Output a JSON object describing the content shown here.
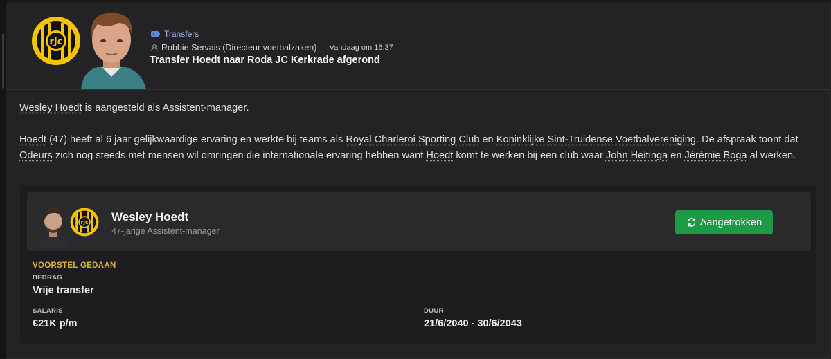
{
  "message": {
    "category": "Transfers",
    "sender": "Robbie Servais (Directeur voetbalzaken)",
    "separator": "-",
    "time": "Vandaag om 16:37",
    "subject": "Transfer Hoedt naar Roda JC Kerkrade afgerond",
    "club_logo_text": "RODA JC KERKRADE",
    "icons": {
      "category": "tag-icon",
      "sender": "person-icon"
    }
  },
  "body": {
    "p1": [
      {
        "text": "Wesley Hoedt",
        "link": true
      },
      {
        "text": " is aangesteld als Assistent-manager.",
        "link": false
      }
    ],
    "p2": [
      {
        "text": "Hoedt",
        "link": true
      },
      {
        "text": " (47) heeft al 6 jaar gelijkwaardige ervaring en werkte bij teams als ",
        "link": false
      },
      {
        "text": "Royal Charleroi Sporting Club",
        "link": true
      },
      {
        "text": " en ",
        "link": false
      },
      {
        "text": "Koninklijke Sint-Truidense Voetbalvereniging",
        "link": true
      },
      {
        "text": ". De afspraak toont dat ",
        "link": false
      },
      {
        "text": "Odeurs",
        "link": true
      },
      {
        "text": " zich nog steeds met mensen wil omringen die internationale ervaring hebben want ",
        "link": false
      },
      {
        "text": "Hoedt",
        "link": true
      },
      {
        "text": " komt te werken bij een club waar ",
        "link": false
      },
      {
        "text": "John Heitinga",
        "link": true
      },
      {
        "text": " en ",
        "link": false
      },
      {
        "text": "Jérémie Boga",
        "link": true
      },
      {
        "text": " al werken.",
        "link": false
      }
    ]
  },
  "card": {
    "name": "Wesley Hoedt",
    "role": "47-jarige Assistent-manager",
    "status_button": "Aangetrokken",
    "status_icon": "refresh-icon",
    "offer_status": "VOORSTEL GEDAAN",
    "fee_label": "BEDRAG",
    "fee_value": "Vrije transfer",
    "salary_label": "SALARIS",
    "salary_value": "€21K p/m",
    "duration_label": "DUUR",
    "duration_value": "21/6/2040 - 30/6/2043"
  },
  "colors": {
    "accent_green": "#1e9a46",
    "status_gold": "#d8b23a",
    "club_yellow": "#f5c400",
    "category_blue": "#9fb8e6"
  }
}
